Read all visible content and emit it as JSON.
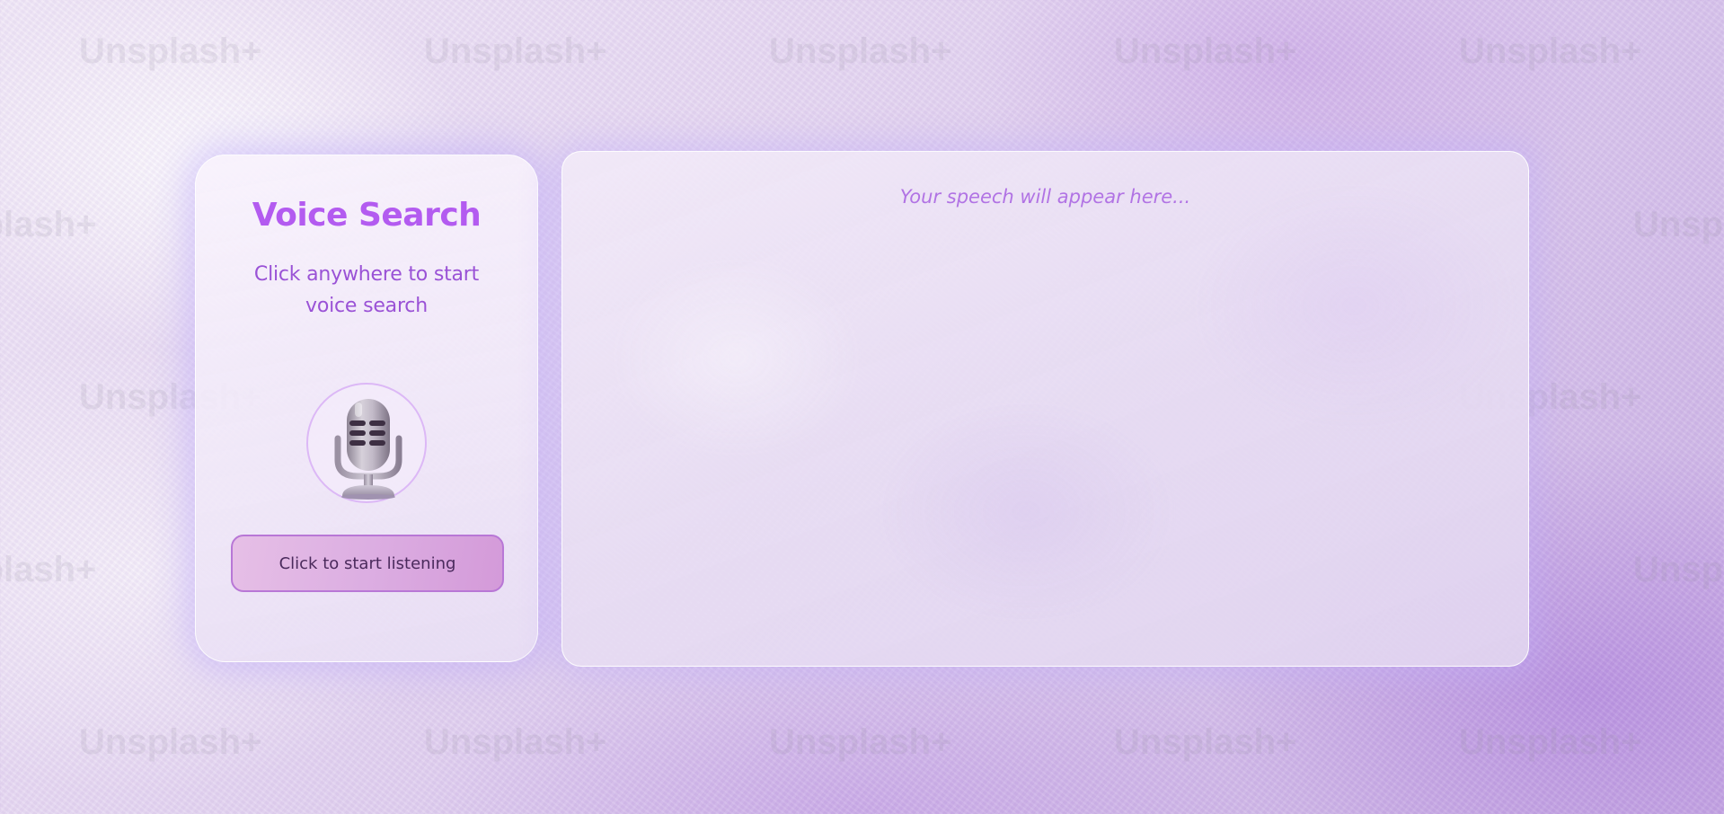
{
  "background": {
    "watermark_text": "Unsplash+"
  },
  "voice_card": {
    "title": "Voice Search",
    "subtitle": "Click anywhere to start voice search",
    "mic_icon": "microphone-icon",
    "button_label": "Click to start listening"
  },
  "output": {
    "placeholder": "Your speech will appear here..."
  },
  "colors": {
    "title": "#b35bf0",
    "subtitle": "#9a52d6",
    "placeholder": "#b173e4",
    "button_border": "#b877d6",
    "ring": "#dcb8f6"
  }
}
